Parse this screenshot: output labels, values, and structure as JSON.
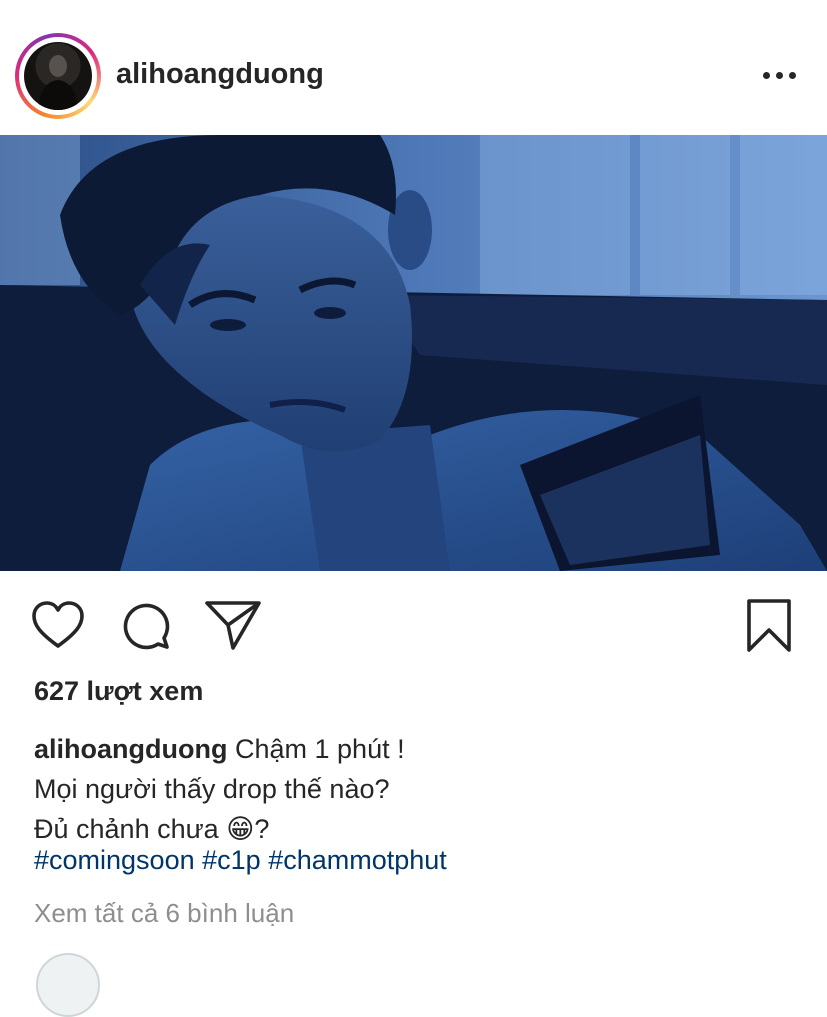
{
  "post": {
    "username": "alihoangduong",
    "more_icon": "more-horizontal-icon",
    "views_text": "627 lượt xem",
    "caption": {
      "username": "alihoangduong",
      "line1": "Chậm 1 phút !",
      "line2": "Mọi người thấy drop thế nào?",
      "line3_text": "Đủ chảnh chưa ",
      "line3_emoji": "😁",
      "line3_end": "?"
    },
    "hashtags": [
      "#comingsoon",
      "#c1p",
      "#chammotphut"
    ],
    "view_comments": "Xem tất cả 6 bình luận"
  },
  "icons": {
    "like": "heart-icon",
    "comment": "comment-bubble-icon",
    "share": "paper-plane-icon",
    "save": "bookmark-icon"
  },
  "colors": {
    "text": "#262626",
    "hashtag": "#003569",
    "muted": "#8e8e8e",
    "photo_tint": "#1e3c78"
  }
}
